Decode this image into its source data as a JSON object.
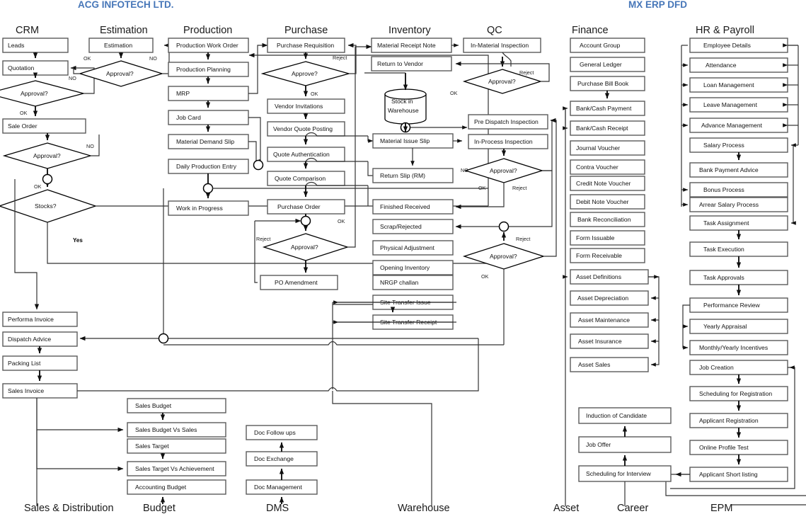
{
  "titles": {
    "left": "ACG INFOTECH LTD.",
    "right": "MX ERP DFD"
  },
  "column_headers": [
    {
      "key": "crm",
      "label": "CRM"
    },
    {
      "key": "estimation",
      "label": "Estimation"
    },
    {
      "key": "production",
      "label": "Production"
    },
    {
      "key": "purchase",
      "label": "Purchase"
    },
    {
      "key": "inventory",
      "label": "Inventory"
    },
    {
      "key": "qc",
      "label": "QC"
    },
    {
      "key": "finance",
      "label": "Finance"
    },
    {
      "key": "hr",
      "label": "HR & Payroll"
    }
  ],
  "footer_labels": [
    {
      "key": "sales",
      "label": "Sales & Distribution"
    },
    {
      "key": "budget",
      "label": "Budget"
    },
    {
      "key": "dms",
      "label": "DMS"
    },
    {
      "key": "warehouse",
      "label": "Warehouse"
    },
    {
      "key": "asset",
      "label": "Asset"
    },
    {
      "key": "career",
      "label": "Career"
    },
    {
      "key": "epm",
      "label": "EPM"
    }
  ],
  "crm": {
    "nodes": [
      "Leads",
      "Quotation",
      "Sale Order",
      "Performa Invoice",
      "Dispatch Advice",
      "Packing List",
      "Sales Invoice"
    ],
    "decisions": [
      "Approval?",
      "Approval?",
      "Stocks?"
    ],
    "edge_labels": [
      "NO",
      "OK",
      "NO",
      "OK",
      "OK",
      "Yes"
    ]
  },
  "estimation": {
    "nodes": [
      "Estimation"
    ],
    "decisions": [
      "Approval?"
    ],
    "edge_labels": [
      "OK",
      "NO"
    ]
  },
  "production": {
    "nodes": [
      "Production Work Order",
      "Production Planning",
      "MRP",
      "Job Card",
      "Material Demand Slip",
      "Daily Production Entry",
      "Work in Progress"
    ],
    "edge_labels": [
      "NO"
    ]
  },
  "purchase": {
    "nodes": [
      "Purchase Requisition",
      "Vendor Invitations",
      "Vendor Quote Posting",
      "Quote Authentication",
      "Quote Comparison",
      "Purchase Order",
      "PO Amendment"
    ],
    "decisions": [
      "Approve?",
      "Approval?"
    ],
    "edge_labels": [
      "Reject",
      "OK",
      "OK",
      "Reject"
    ]
  },
  "inventory": {
    "nodes": [
      "Material Receipt Note",
      "Return to Vendor",
      "Material Issue Slip",
      "Return Slip (RM)",
      "Finished Received",
      "Scrap/Rejected",
      "Physical Adjustment",
      "Opening Inventory",
      "NRGP  challan",
      "Site Transfer Issue",
      "Site Transfer Receipt"
    ],
    "store": "Stock in Warehouse",
    "store_line1": "Stock in",
    "store_line2": "Warehouse"
  },
  "qc": {
    "nodes": [
      "In-Material Inspection",
      "Pre Dispatch Inspection",
      "In-Process Inspection"
    ],
    "decisions": [
      "Approval?",
      "Approval?",
      "Approval?"
    ],
    "edge_labels": [
      "Reject",
      "OK",
      "OK",
      "Reject",
      "Reject",
      "OK"
    ]
  },
  "finance": {
    "nodes": [
      "Account Group",
      "General Ledger",
      "Purchase Bill Book",
      "Bank/Cash Payment",
      "Bank/Cash Receipt",
      "Journal Voucher",
      "Contra Voucher",
      "Credit Note Voucher",
      "Debit Note Voucher",
      "Bank Reconciliation",
      "Form Issuable",
      "Form Receivable"
    ],
    "asset_nodes": [
      "Asset Definitions",
      "Asset Depreciation",
      "Asset Maintenance",
      "Asset Insurance",
      "Asset Sales"
    ]
  },
  "hr": {
    "nodes": [
      "Employee Details",
      "Attendance",
      "Loan Management",
      "Leave Management",
      "Advance Management",
      "Salary Process",
      "Bank Payment Advice",
      "Bonus Process",
      "Arrear Salary Process",
      "Task Assignment",
      "Task Execution",
      "Task Approvals",
      "Performance Review",
      "Yearly Appraisal",
      "Monthly/Yearly Incentives",
      "Job Creation",
      "Scheduling for Registration",
      "Applicant Registration",
      "Online Profile Test",
      "Applicant Short listing"
    ]
  },
  "career": {
    "nodes": [
      "Induction of Candidate",
      "Job Offer",
      "Scheduling for Interview"
    ]
  },
  "budget": {
    "nodes": [
      "Sales Budget",
      "Sales Budget Vs Sales",
      "Sales Target",
      "Sales Target Vs Achievement",
      "Accounting Budget"
    ]
  },
  "dms": {
    "nodes": [
      "Doc Follow ups",
      "Doc Exchange",
      "Doc Management"
    ]
  },
  "colors": {
    "title": "#4676b8",
    "box_stroke": "#5a5a5a",
    "line": "#333333",
    "text": "#111111",
    "background": "#ffffff"
  }
}
